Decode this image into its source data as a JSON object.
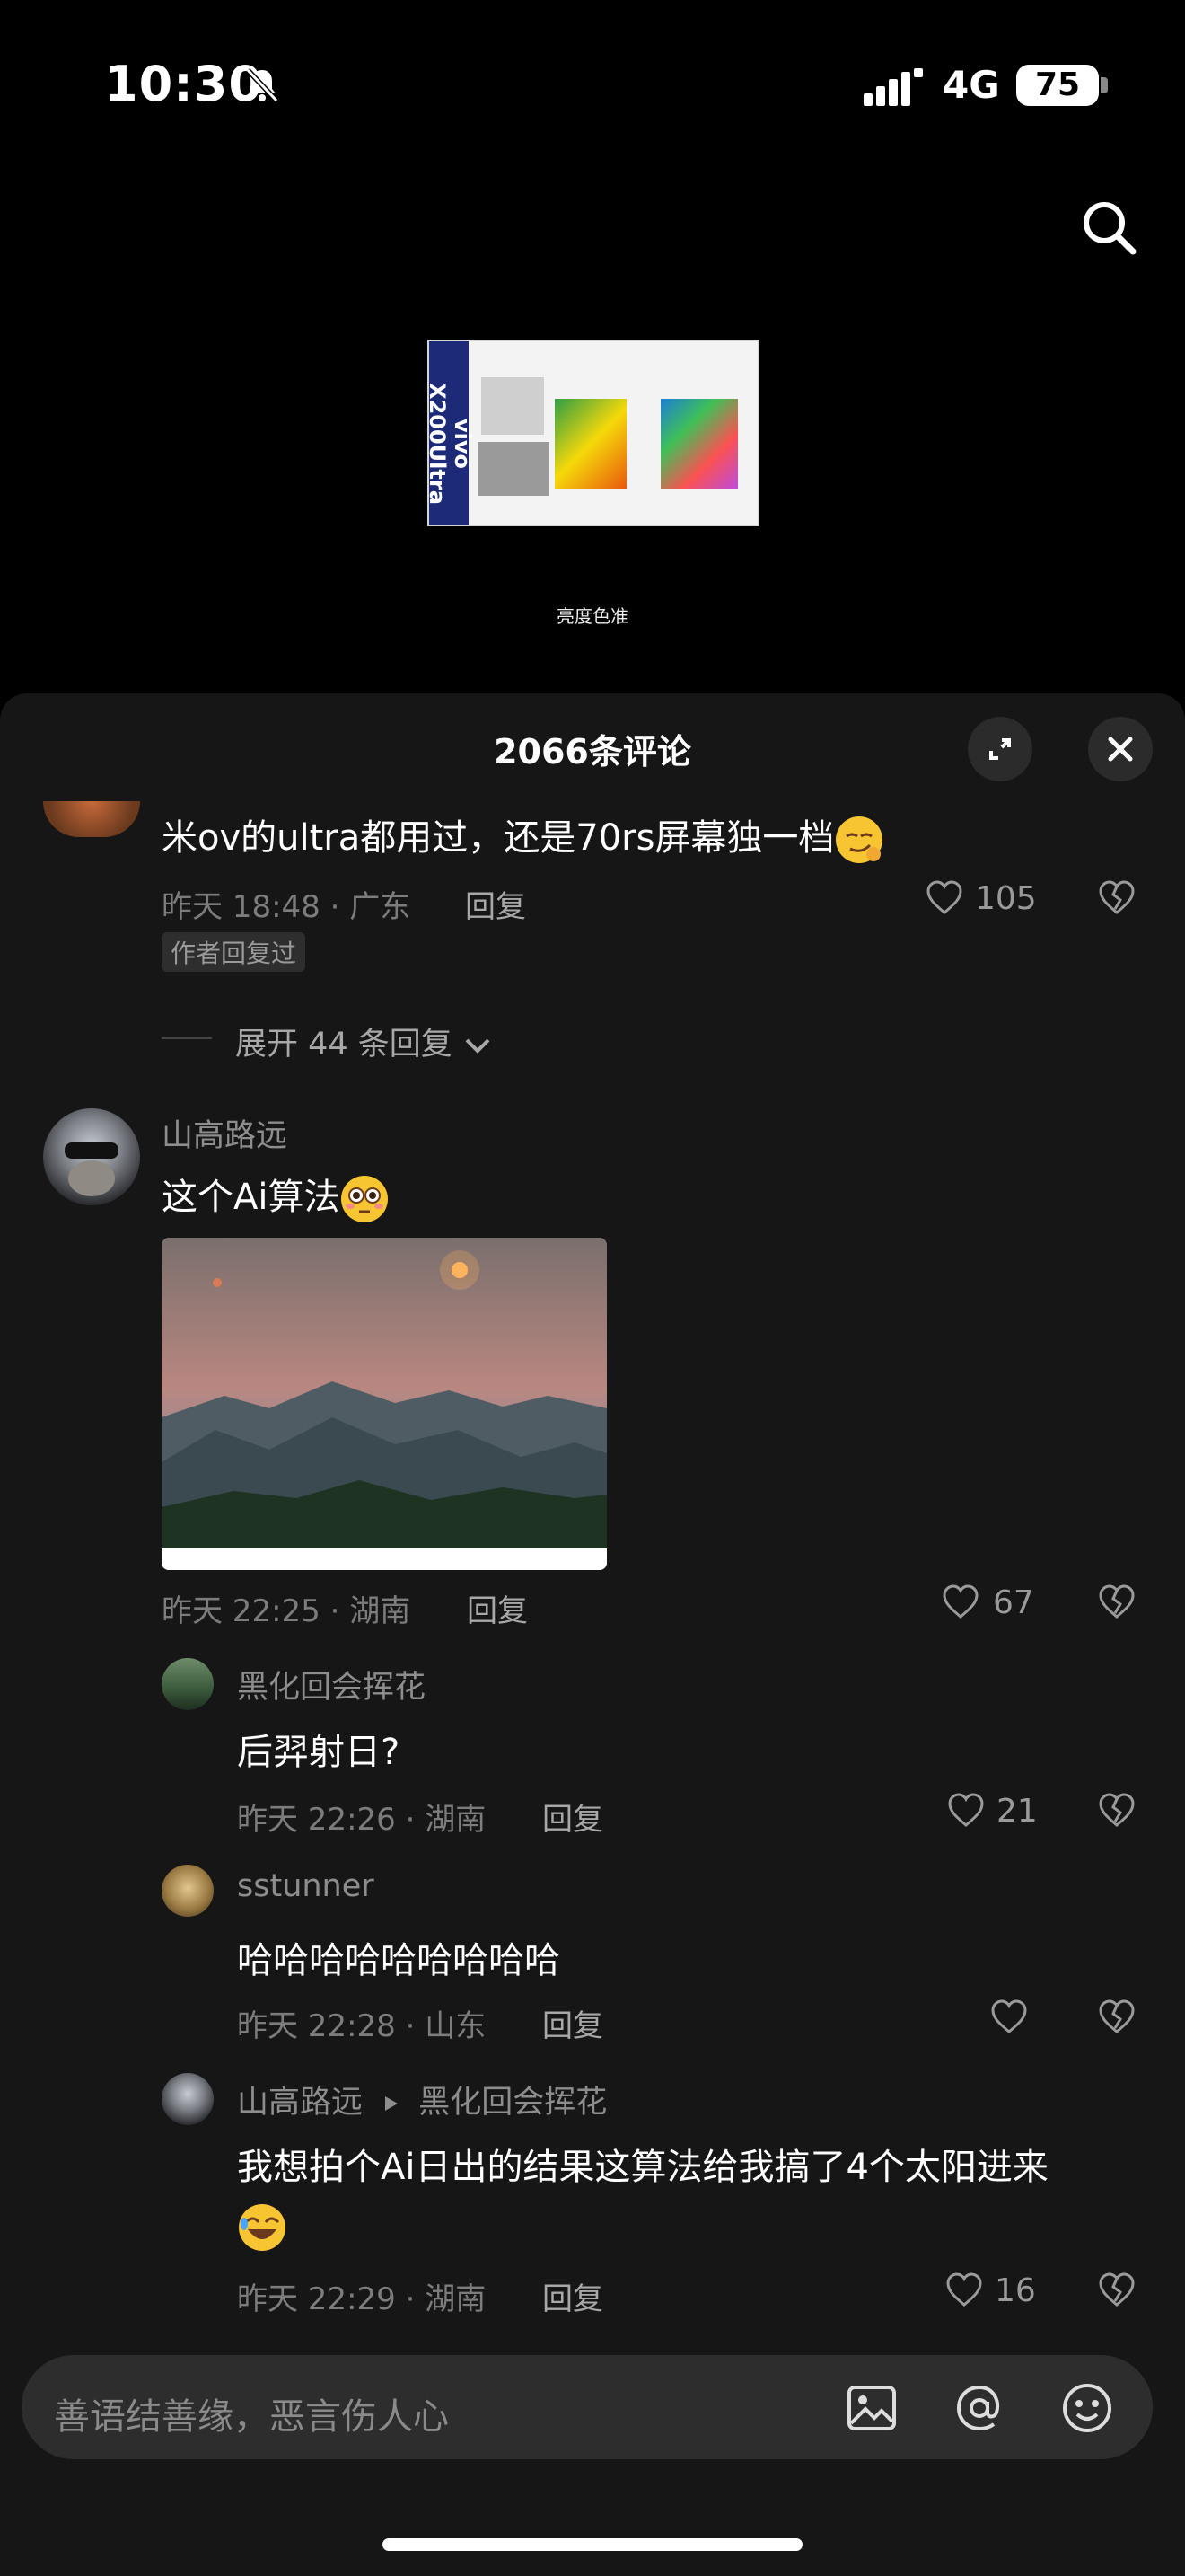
{
  "status_bar": {
    "time": "10:30",
    "network": "4G",
    "battery": "75"
  },
  "video": {
    "caption": "亮度色准",
    "side_text": "vivo X200Ultra"
  },
  "comments_panel": {
    "title": "2066条评论",
    "input_placeholder": "善语结善缘，恶言伤人心",
    "comments": [
      {
        "text": "米ov的ultra都用过，还是70rs屏幕独一档",
        "time": "昨天 18:48 · 广东",
        "reply": "回复",
        "likes": "105",
        "author_tag": "作者回复过",
        "expand": "展开 44 条回复"
      },
      {
        "user": "山高路远",
        "text": "这个Ai算法",
        "time": "昨天 22:25 · 湖南",
        "reply": "回复",
        "likes": "67"
      }
    ],
    "replies": [
      {
        "user": "黑化回会挥花",
        "text": "后羿射日?",
        "time": "昨天 22:26 · 湖南",
        "reply": "回复",
        "likes": "21"
      },
      {
        "user": "sstunner",
        "text": "哈哈哈哈哈哈哈哈哈",
        "time": "昨天 22:28 · 山东",
        "reply": "回复",
        "likes": ""
      },
      {
        "user": "山高路远",
        "reply_to": "黑化回会挥花",
        "text_line1": "我想拍个Ai日出的结果这算法给我搞了4个太阳进来",
        "time": "昨天 22:29 · 湖南",
        "reply": "回复",
        "likes": "16"
      }
    ]
  },
  "colors": {
    "background": "#000000",
    "sheet": "#161616",
    "muted": "#8d8d8d"
  }
}
